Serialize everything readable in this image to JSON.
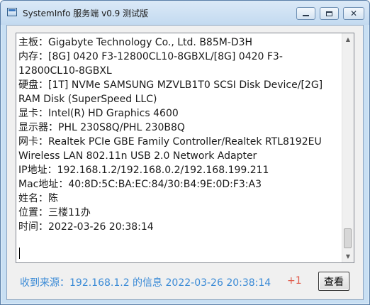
{
  "window": {
    "title": "SystemInfo 服务端 v0.9 测试版"
  },
  "info_lines": [
    "主板：Gigabyte Technology Co., Ltd. B85M-D3H",
    "内存：[8G] 0420 F3-12800CL10-8GBXL/[8G] 0420 F3-12800CL10-8GBXL",
    "硬盘：[1T] NVMe SAMSUNG MZVLB1T0 SCSI Disk Device/[2G] RAM Disk (SuperSpeed LLC)",
    "显卡：Intel(R) HD Graphics 4600",
    "显示器：PHL 230S8Q/PHL 230B8Q",
    "网卡：Realtek PCIe GBE Family Controller/Realtek RTL8192EU Wireless LAN 802.11n USB 2.0 Network Adapter",
    "IP地址：192.168.1.2/192.168.0.2/192.168.199.211",
    "Mac地址：40:8D:5C:BA:EC:84/30:B4:9E:0D:F3:A3",
    "姓名：陈",
    "位置：三楼11办",
    "时间：2022-03-26 20:38:14"
  ],
  "status": {
    "text": "收到来源：192.168.1.2 的信息 2022-03-26 20:38:14",
    "counter": "+1"
  },
  "buttons": {
    "view": "查看"
  },
  "colors": {
    "status_text": "#3a8ad6",
    "counter_text": "#e05a4a"
  }
}
